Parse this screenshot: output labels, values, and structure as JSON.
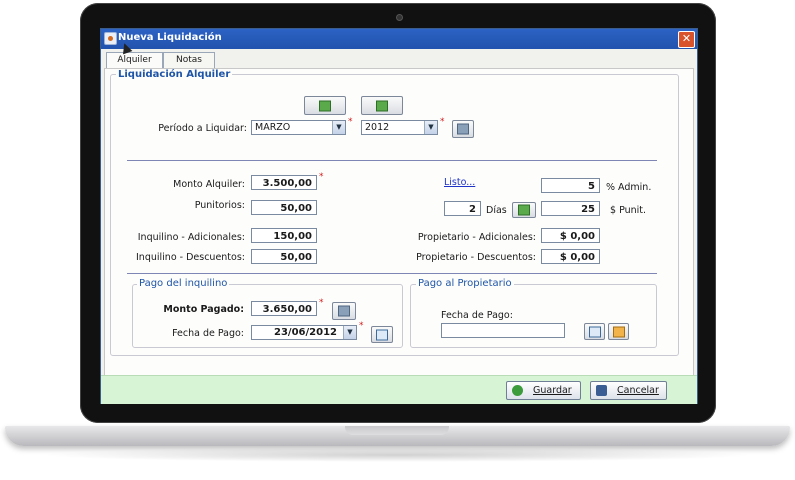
{
  "window": {
    "title": "Nueva Liquidación",
    "close_glyph": "✕"
  },
  "tabs": [
    {
      "label": "Alquiler"
    },
    {
      "label": "Notas"
    }
  ],
  "liquidacion": {
    "legend": "Liquidación Alquiler",
    "periodo_label": "Período a Liquidar:",
    "month": "MARZO",
    "year": "2012",
    "required_mark": "*"
  },
  "montos": {
    "monto_alquiler_label": "Monto Alquiler:",
    "monto_alquiler": "3.500,00",
    "punitorios_label": "Punitorios:",
    "punitorios": "50,00",
    "inq_adicionales_label": "Inquilino - Adicionales:",
    "inq_adicionales": "150,00",
    "inq_descuentos_label": "Inquilino - Descuentos:",
    "inq_descuentos": "50,00",
    "listo_link": "Listo...",
    "admin_pct": "5",
    "admin_label": "% Admin.",
    "dias_value": "2",
    "dias_label": "Días",
    "punit_value": "25",
    "punit_label": "$ Punit.",
    "prop_adicionales_label": "Propietario - Adicionales:",
    "prop_adicionales": "$ 0,00",
    "prop_descuentos_label": "Propietario - Descuentos:",
    "prop_descuentos": "$ 0,00"
  },
  "pago_inquilino": {
    "legend": "Pago del inquilino",
    "monto_label": "Monto Pagado:",
    "monto": "3.650,00",
    "fecha_label": "Fecha de Pago:",
    "fecha": "23/06/2012"
  },
  "pago_propietario": {
    "legend": "Pago al Propietario",
    "fecha_label": "Fecha de Pago:",
    "fecha": ""
  },
  "footer": {
    "guardar": "Guardar",
    "cancelar": "Cancelar"
  },
  "colors": {
    "titlebar": "#2559b8",
    "footer": "#d7f5d5",
    "legend": "#1f55a7",
    "link": "#2033c8"
  }
}
